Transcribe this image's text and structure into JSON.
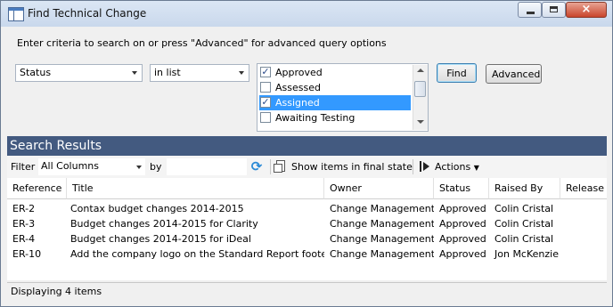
{
  "window": {
    "title": "Find Technical Change",
    "close_glyph": "×"
  },
  "criteria": {
    "instructions": "Enter criteria to search on or press \"Advanced\" for advanced query options",
    "field": "Status",
    "operator": "in list",
    "options": [
      {
        "label": "Approved",
        "checked": true,
        "selected": false
      },
      {
        "label": "Assessed",
        "checked": false,
        "selected": false
      },
      {
        "label": "Assigned",
        "checked": true,
        "selected": true
      },
      {
        "label": "Awaiting Testing",
        "checked": false,
        "selected": false
      }
    ],
    "find_label": "Find",
    "advanced_label": "Advanced"
  },
  "results": {
    "title": "Search Results",
    "toolbar": {
      "filter_label": "Filter",
      "filter_column": "All Columns",
      "by_label": "by",
      "filter_value": "",
      "final_state_label": "Show items in final state",
      "actions_label": "Actions"
    },
    "columns": [
      "Reference",
      "Title",
      "Owner",
      "Status",
      "Raised By",
      "Release"
    ],
    "rows": [
      [
        "ER-2",
        "Contax budget changes 2014-2015",
        "Change Management",
        "Approved",
        "Colin Cristal",
        ""
      ],
      [
        "ER-3",
        "Budget changes 2014-2015 for Clarity",
        "Change Management",
        "Approved",
        "Colin Cristal",
        ""
      ],
      [
        "ER-4",
        "Budget changes 2014-2015 for iDeal",
        "Change Management",
        "Approved",
        "Colin Cristal",
        ""
      ],
      [
        "ER-10",
        "Add the company logo on the Standard Report footer",
        "Change Management",
        "Approved",
        "Jon McKenzie",
        ""
      ]
    ],
    "status_text": "Displaying 4 items"
  },
  "icons": {
    "app": "window-icon",
    "refresh": "refresh-icon",
    "final_state": "document-icon",
    "actions": "play-icon"
  }
}
